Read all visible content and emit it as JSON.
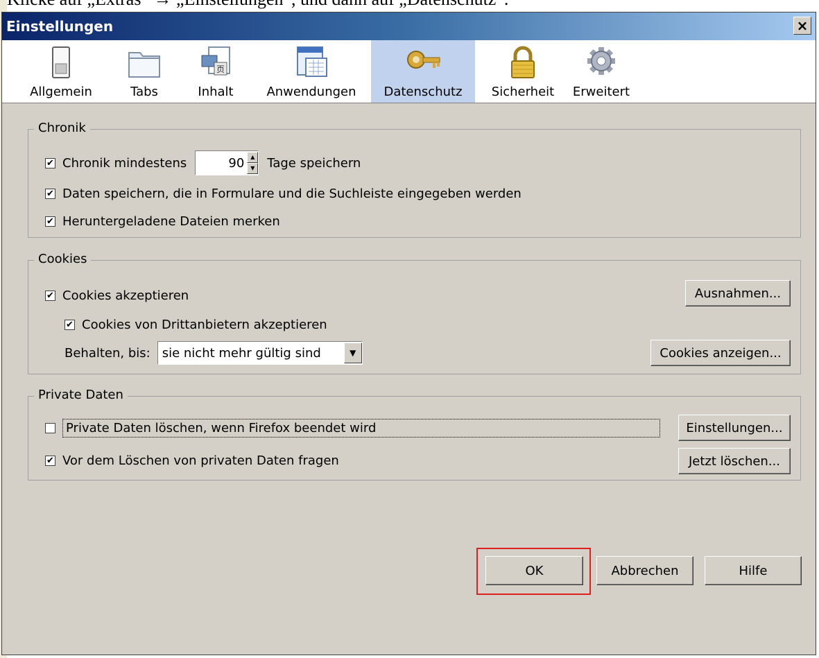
{
  "background": {
    "text": "Klicke auf „Extras“ → „Einstellungen“, und dann auf „Datenschutz“."
  },
  "window": {
    "title": "Einstellungen",
    "close_label": "×"
  },
  "tabs": [
    {
      "label": "Allgemein",
      "icon": "toggle-switch-icon"
    },
    {
      "label": "Tabs",
      "icon": "folder-tabs-icon"
    },
    {
      "label": "Inhalt",
      "icon": "content-icon"
    },
    {
      "label": "Anwendungen",
      "icon": "applications-icon"
    },
    {
      "label": "Datenschutz",
      "icon": "key-icon"
    },
    {
      "label": "Sicherheit",
      "icon": "padlock-icon"
    },
    {
      "label": "Erweitert",
      "icon": "gear-icon"
    }
  ],
  "selected_tab": "Datenschutz",
  "history": {
    "legend": "Chronik",
    "keep_prefix": "Chronik mindestens",
    "keep_days": "90",
    "keep_suffix": "Tage speichern",
    "forms_label": "Daten speichern, die in Formulare und die Suchleiste eingegeben werden",
    "downloads_label": "Heruntergeladene Dateien merken",
    "keep_checked": true,
    "forms_checked": true,
    "downloads_checked": true
  },
  "cookies": {
    "legend": "Cookies",
    "accept_label": "Cookies akzeptieren",
    "third_party_label": "Cookies von Drittanbietern akzeptieren",
    "keep_until_label": "Behalten, bis:",
    "keep_until_value": "sie nicht mehr gültig sind",
    "exceptions_button": "Ausnahmen...",
    "show_button": "Cookies anzeigen...",
    "accept_checked": true,
    "third_party_checked": true
  },
  "private_data": {
    "legend": "Private Daten",
    "clear_on_exit_label": "Private Daten löschen, wenn Firefox beendet wird",
    "ask_label": "Vor dem Löschen von privaten Daten fragen",
    "settings_button": "Einstellungen...",
    "clear_now_button": "Jetzt löschen...",
    "clear_on_exit_checked": false,
    "ask_checked": true
  },
  "footer": {
    "ok": "OK",
    "cancel": "Abbrechen",
    "help": "Hilfe"
  },
  "colors": {
    "highlight_box": "#e02020",
    "selected_tab": "#c1d2ee",
    "dialog_bg": "#d4d0c8"
  }
}
